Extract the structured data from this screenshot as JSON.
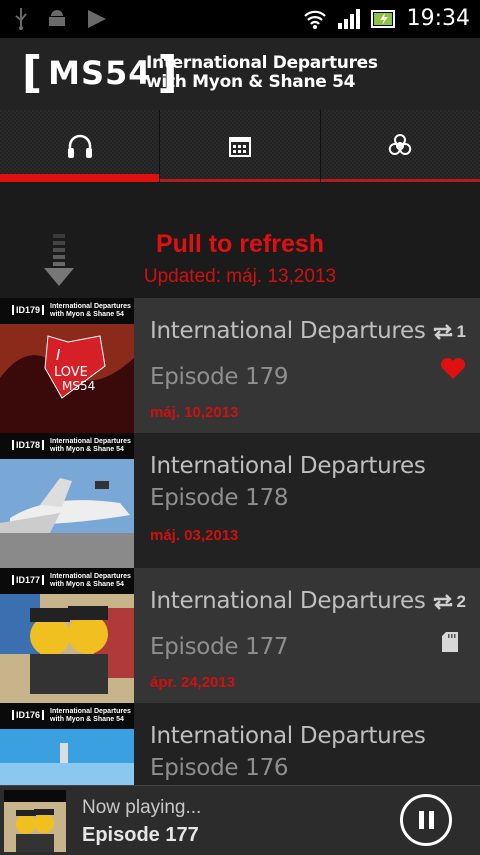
{
  "status_bar": {
    "time": "19:34",
    "icons": [
      "usb-icon",
      "android-debug-icon",
      "play-store-icon",
      "wifi-icon",
      "signal-icon",
      "battery-charging-icon"
    ]
  },
  "header": {
    "logo": "MS54",
    "title_line1": "International Departures",
    "title_line2": "with Myon & Shane 54"
  },
  "tabs": [
    {
      "icon": "headphones-icon",
      "active": true
    },
    {
      "icon": "calendar-icon",
      "active": false
    },
    {
      "icon": "biohazard-icon",
      "active": false
    }
  ],
  "refresh": {
    "title": "Pull to refresh",
    "updated": "Updated: máj. 13,2013"
  },
  "episodes": [
    {
      "title": "International Departures",
      "episode": "Episode 179",
      "date": "máj. 10,2013",
      "repeat_count": "1",
      "favorite": true,
      "on_sd": false,
      "thumb_id": "ID179"
    },
    {
      "title": "International Departures",
      "episode": "Episode 178",
      "date": "máj. 03,2013",
      "repeat_count": "",
      "favorite": false,
      "on_sd": false,
      "thumb_id": "ID178"
    },
    {
      "title": "International Departures",
      "episode": "Episode 177",
      "date": "ápr. 24,2013",
      "repeat_count": "2",
      "favorite": false,
      "on_sd": true,
      "thumb_id": "ID177"
    },
    {
      "title": "International Departures",
      "episode": "Episode 176",
      "date": "",
      "repeat_count": "",
      "favorite": false,
      "on_sd": false,
      "thumb_id": "ID176"
    }
  ],
  "thumb_caption": "International Departures with Myon & Shane 54",
  "now_playing": {
    "label": "Now playing...",
    "episode": "Episode 177"
  },
  "colors": {
    "accent": "#e01010",
    "background": "#1b1b1b"
  }
}
